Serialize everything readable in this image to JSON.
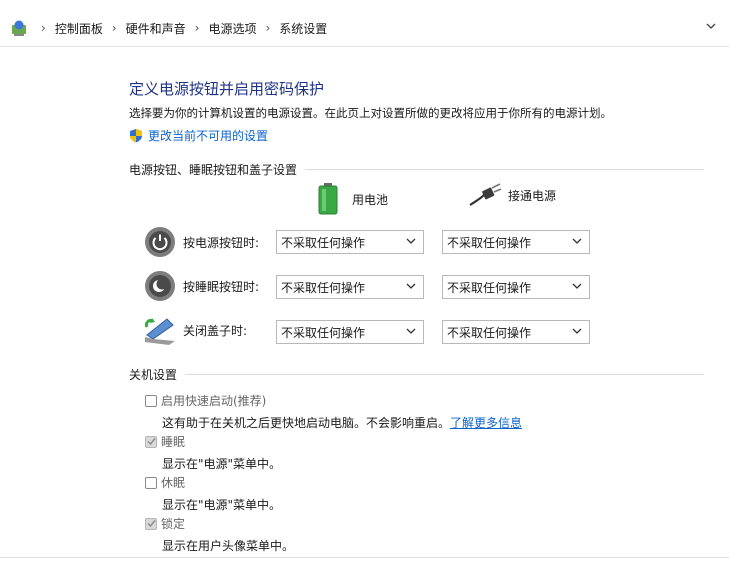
{
  "breadcrumb": [
    "控制面板",
    "硬件和声音",
    "电源选项",
    "系统设置"
  ],
  "page": {
    "title": "定义电源按钮并启用密码保护",
    "description": "选择要为你的计算机设置的电源设置。在此页上对设置所做的更改将应用于你所有的电源计划。",
    "change_link": "更改当前不可用的设置"
  },
  "buttons_section": {
    "heading": "电源按钮、睡眠按钮和盖子设置",
    "battery_label": "用电池",
    "plugged_label": "接通电源",
    "rows": [
      {
        "label": "按电源按钮时:",
        "battery": "不采取任何操作",
        "plugged": "不采取任何操作"
      },
      {
        "label": "按睡眠按钮时:",
        "battery": "不采取任何操作",
        "plugged": "不采取任何操作"
      },
      {
        "label": "关闭盖子时:",
        "battery": "不采取任何操作",
        "plugged": "不采取任何操作"
      }
    ]
  },
  "shutdown_section": {
    "heading": "关机设置",
    "items": [
      {
        "label": "启用快速启动(推荐)",
        "checked": false,
        "desc": "这有助于在关机之后更快地启动电脑。不会影响重启。",
        "link": "了解更多信息"
      },
      {
        "label": "睡眠",
        "checked": true,
        "desc": "显示在\"电源\"菜单中。"
      },
      {
        "label": "休眠",
        "checked": false,
        "desc": "显示在\"电源\"菜单中。"
      },
      {
        "label": "锁定",
        "checked": true,
        "desc": "显示在用户头像菜单中。"
      }
    ]
  },
  "colors": {
    "title": "#1e3287",
    "link": "#0b63ce",
    "battery": "#3aa845"
  }
}
